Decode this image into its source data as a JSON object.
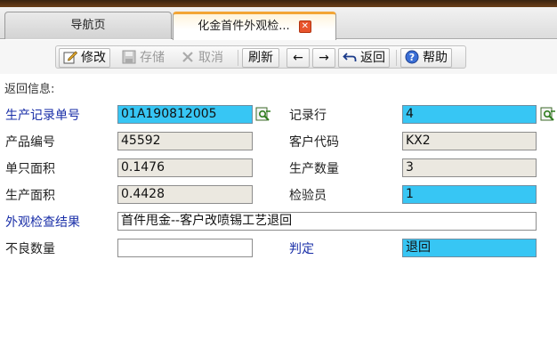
{
  "tabs": [
    {
      "label": "导航页"
    },
    {
      "label": "化金首件外观检...",
      "close": "✕"
    }
  ],
  "toolbar": {
    "edit": "修改",
    "save": "存储",
    "cancel": "取消",
    "refresh": "刷新",
    "prev": "←",
    "next": "→",
    "back": "返回",
    "help": "帮助"
  },
  "return_info": "返回信息:",
  "form": {
    "record_no_label": "生产记录单号",
    "record_no": "01A190812005",
    "record_row_label": "记录行",
    "record_row": "4",
    "product_no_label": "产品编号",
    "product_no": "45592",
    "customer_code_label": "客户代码",
    "customer_code": "KX2",
    "unit_area_label": "单只面积",
    "unit_area": "0.1476",
    "production_qty_label": "生产数量",
    "production_qty": "3",
    "production_area_label": "生产面积",
    "production_area": "0.4428",
    "inspector_label": "检验员",
    "inspector": "1",
    "visual_result_label": "外观检查结果",
    "visual_result": "首件甩金--客户改喷锡工艺退回",
    "defect_qty_label": "不良数量",
    "defect_qty": "",
    "judgement_label": "判定",
    "judgement": "退回"
  },
  "colors": {
    "tab_accent": "#f3a535",
    "cyan_field": "#37c6f4",
    "blue_label": "#1a2fa8"
  }
}
